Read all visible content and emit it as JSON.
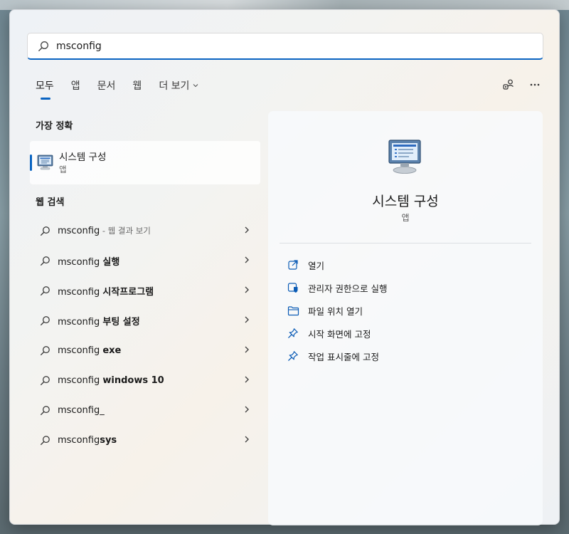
{
  "search": {
    "value": "msconfig"
  },
  "tabs": [
    {
      "label": "모두"
    },
    {
      "label": "앱"
    },
    {
      "label": "문서"
    },
    {
      "label": "웹"
    },
    {
      "label": "더 보기"
    }
  ],
  "sections": {
    "best_match": "가장 정확",
    "web_search": "웹 검색"
  },
  "best_match": {
    "name": "시스템 구성",
    "type": "앱"
  },
  "web_results": [
    {
      "prefix": "msconfig",
      "bold": "",
      "hint": " - 웹 결과 보기"
    },
    {
      "prefix": "msconfig ",
      "bold": "실행",
      "hint": ""
    },
    {
      "prefix": "msconfig ",
      "bold": "시작프로그램",
      "hint": ""
    },
    {
      "prefix": "msconfig ",
      "bold": "부팅 설정",
      "hint": ""
    },
    {
      "prefix": "msconfig ",
      "bold": "exe",
      "hint": ""
    },
    {
      "prefix": "msconfig ",
      "bold": "windows 10",
      "hint": ""
    },
    {
      "prefix": "msconfig_",
      "bold": "",
      "hint": ""
    },
    {
      "prefix": "msconfig",
      "bold": "sys",
      "hint": ""
    }
  ],
  "preview": {
    "name": "시스템 구성",
    "type": "앱",
    "actions": [
      {
        "label": "열기",
        "icon": "open-icon"
      },
      {
        "label": "관리자 권한으로 실행",
        "icon": "admin-shield-icon"
      },
      {
        "label": "파일 위치 열기",
        "icon": "folder-icon"
      },
      {
        "label": "시작 화면에 고정",
        "icon": "pin-icon"
      },
      {
        "label": "작업 표시줄에 고정",
        "icon": "pin-icon"
      }
    ]
  },
  "colors": {
    "accent": "#0a64c2",
    "panel": "#f3f3f1"
  }
}
